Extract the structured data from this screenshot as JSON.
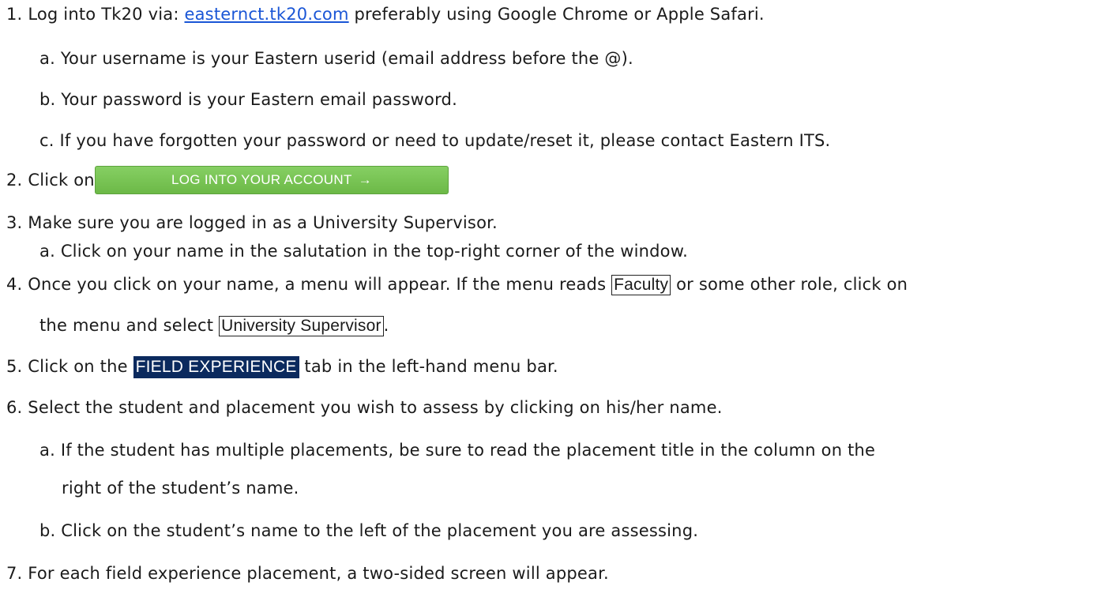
{
  "steps": {
    "s1": {
      "num": "1.",
      "pre": "Log into Tk20 via: ",
      "link": "easternct.tk20.com",
      "post": " preferably using Google Chrome or Apple Safari."
    },
    "s1a": "a.  Your username is your Eastern userid (email address before the @).",
    "s1b": "b.  Your password is your Eastern email password.",
    "s1c": "c.  If you have forgotten your password or need to update/reset it, please contact Eastern ITS.",
    "s2": {
      "num": "2.",
      "text": "Click on",
      "button": "LOG INTO YOUR ACCOUNT",
      "arrow": "→"
    },
    "s3": "3.  Make sure you are logged in as a University Supervisor.",
    "s3a": "a.  Click on your name in the salutation in the top-right corner of the window.",
    "s4": {
      "pre": "4.  Once you click on your name, a menu will appear. If the menu reads ",
      "box1": "Faculty",
      "post1": " or some other role, click on",
      "line2_pre": "the menu and select ",
      "box2": "University Supervisor",
      "line2_post": "."
    },
    "s5": {
      "pre": "5.  Click on the ",
      "tab": "FIELD EXPERIENCE",
      "post": " tab in the left-hand menu bar."
    },
    "s6": "6.  Select the student and placement you wish to assess by clicking on his/her name.",
    "s6a_l1": "a.  If the student has multiple placements, be sure to read the placement title in the column on the",
    "s6a_l2": "right of the student’s name.",
    "s6b": "b.  Click on the student’s name to the left of the placement you are assessing.",
    "s7": "7.  For each field experience placement, a two-sided screen will appear."
  }
}
